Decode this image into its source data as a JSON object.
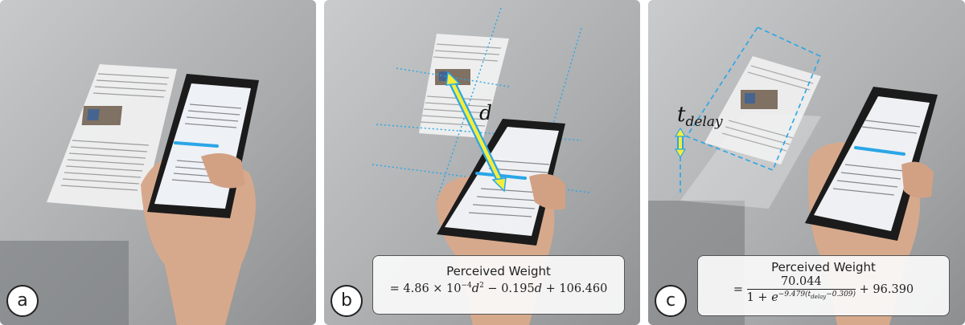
{
  "panels": [
    {
      "label": "a"
    },
    {
      "label": "b",
      "distance_symbol": "d",
      "formula": {
        "title": "Perceived Weight",
        "equation": "= 4.86 × 10⁻⁴d² − 0.195d + 106.460"
      }
    },
    {
      "label": "c",
      "delay_symbol": "t_delay",
      "formula": {
        "title": "Perceived Weight",
        "numerator": "70.044",
        "equation": "= 70.044 / (1 + e^(−9.479(t_delay − 0.309))) + 96.390"
      }
    }
  ],
  "colors": {
    "highlight": "#f4ee3a",
    "accent": "#2aa6e6",
    "background": "#a9abad"
  }
}
